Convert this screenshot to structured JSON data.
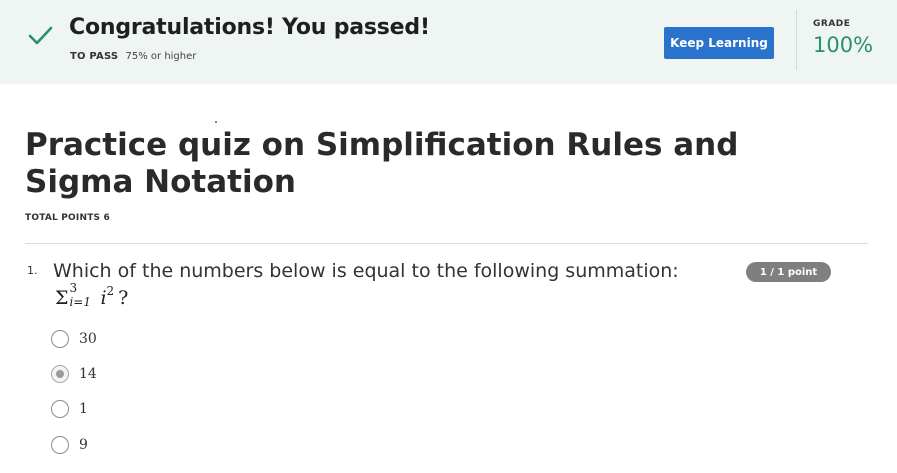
{
  "banner": {
    "title": "Congratulations! You passed!",
    "to_pass_label": "TO PASS",
    "to_pass_value": "75% or higher",
    "keep_learning_label": "Keep Learning",
    "grade_label": "GRADE",
    "grade_value": "100%",
    "success_color": "#2a8f6b",
    "button_color": "#2a73cc"
  },
  "quiz": {
    "title": "Practice quiz on Simplification Rules and Sigma Notation",
    "total_points": "TOTAL POINTS 6"
  },
  "question": {
    "number": "1.",
    "text": "Which of the numbers below is equal to the following summation:",
    "formula": {
      "sigma": "Σ",
      "upper": "3",
      "lower": "i=1",
      "variable": "i",
      "exponent": "2",
      "suffix": "?"
    },
    "points": "1 / 1 point",
    "options": [
      {
        "label": "30",
        "selected": false
      },
      {
        "label": "14",
        "selected": true
      },
      {
        "label": "1",
        "selected": false
      },
      {
        "label": "9",
        "selected": false
      }
    ]
  }
}
